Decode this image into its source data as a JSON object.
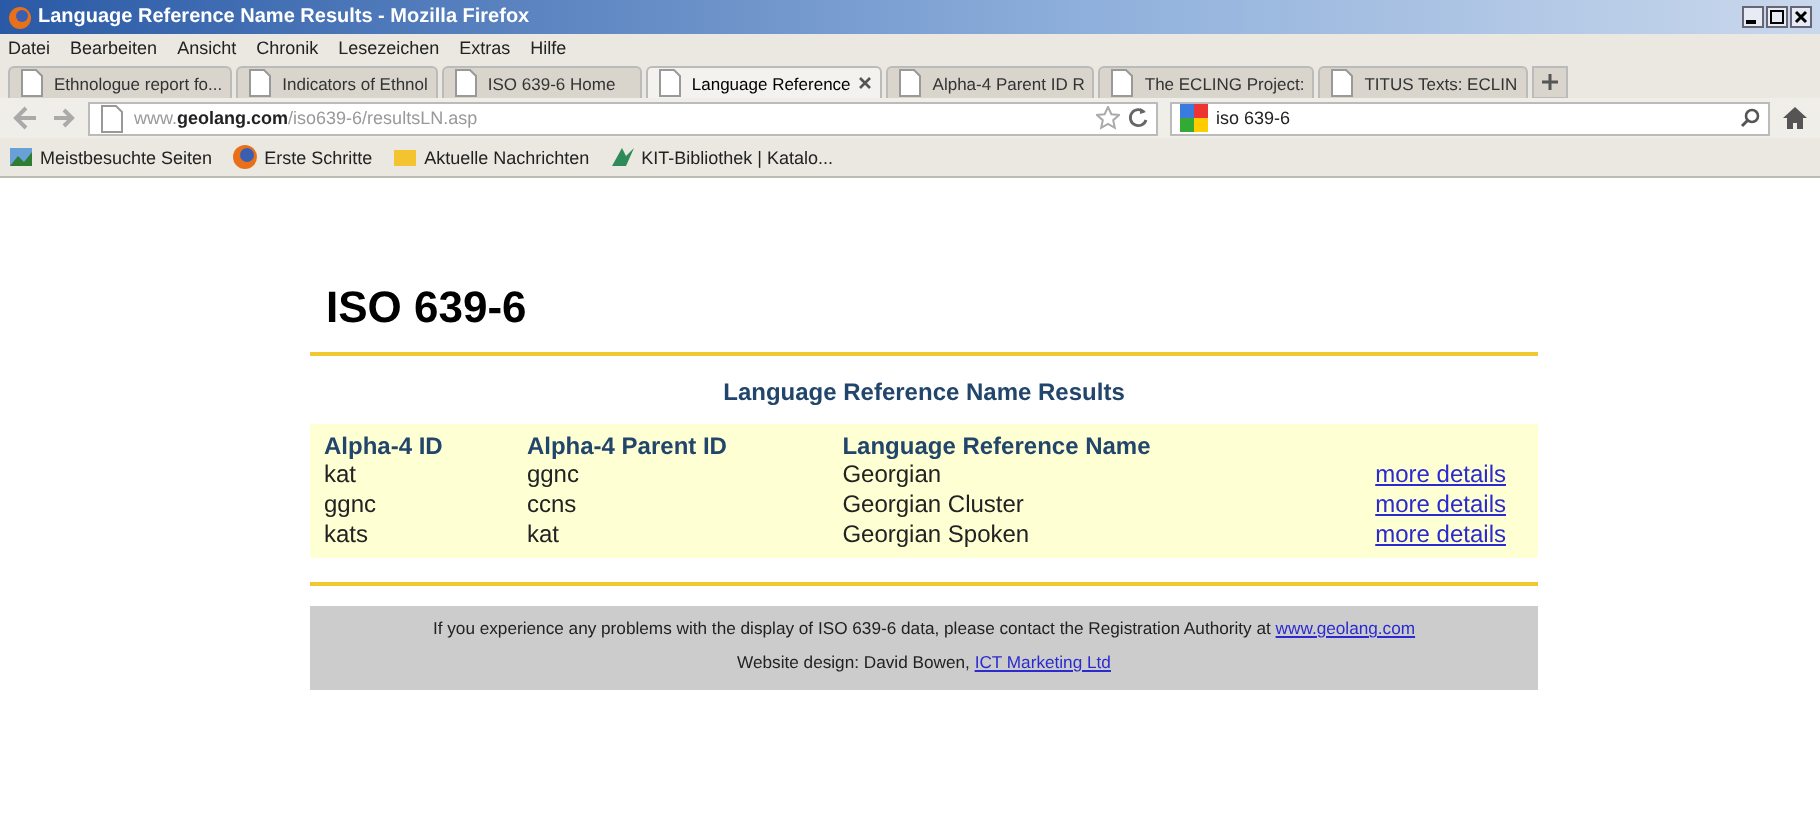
{
  "window": {
    "title": "Language Reference Name Results - Mozilla Firefox"
  },
  "menu": [
    "Datei",
    "Bearbeiten",
    "Ansicht",
    "Chronik",
    "Lesezeichen",
    "Extras",
    "Hilfe"
  ],
  "tabs": [
    {
      "label": "Ethnologue report fo...",
      "selected": false
    },
    {
      "label": "Indicators of Ethnol",
      "selected": false
    },
    {
      "label": "ISO 639-6 Home",
      "selected": false
    },
    {
      "label": "Language Reference",
      "selected": true
    },
    {
      "label": "Alpha-4 Parent ID R",
      "selected": false
    },
    {
      "label": "The ECLING Project:",
      "selected": false
    },
    {
      "label": "TITUS Texts: ECLIN",
      "selected": false
    }
  ],
  "address": {
    "prefix": "www.",
    "domain": "geolang.com",
    "path": "/iso639-6/resultsLN.asp"
  },
  "search": {
    "value": "iso 639-6"
  },
  "bookmarks": [
    "Meistbesuchte Seiten",
    "Erste Schritte",
    "Aktuelle Nachrichten",
    "KIT-Bibliothek | Katalo..."
  ],
  "page": {
    "heading": "ISO 639-6",
    "table_title": "Language Reference Name Results",
    "columns": [
      "Alpha-4 ID",
      "Alpha-4 Parent ID",
      "Language Reference Name"
    ],
    "rows": [
      {
        "cells": [
          "kat",
          "ggnc",
          "Georgian"
        ],
        "link": "more details"
      },
      {
        "cells": [
          "ggnc",
          "ccns",
          "Georgian Cluster"
        ],
        "link": "more details"
      },
      {
        "cells": [
          "kats",
          "kat",
          "Georgian Spoken"
        ],
        "link": "more details"
      }
    ],
    "footer": {
      "notice": "If you experience any problems with the display of ISO 639-6 data, please contact the Registration Authority at",
      "notice_link": "www.geolang.com",
      "credit": "Website design: David Bowen,",
      "credit_link": "ICT Marketing Ltd"
    }
  }
}
